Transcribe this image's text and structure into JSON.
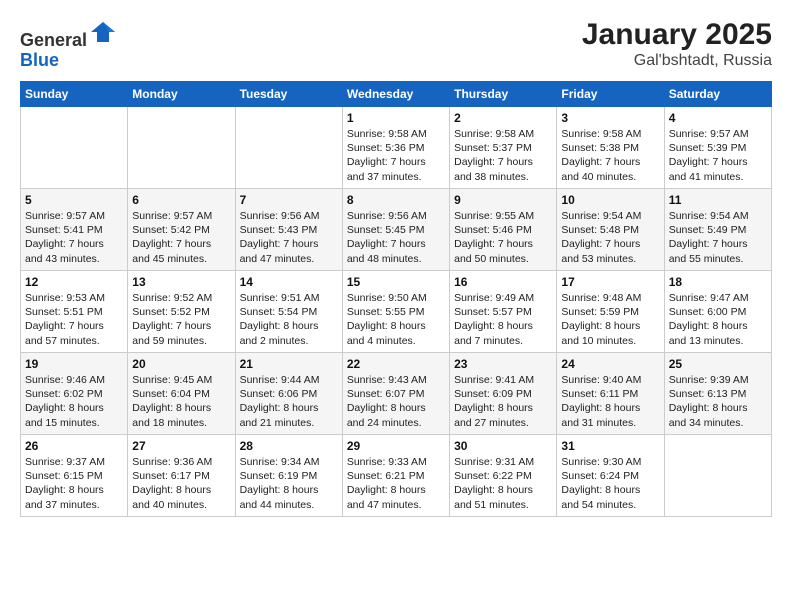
{
  "header": {
    "logo_line1": "General",
    "logo_line2": "Blue",
    "title": "January 2025",
    "subtitle": "Gal'bshtadt, Russia"
  },
  "weekdays": [
    "Sunday",
    "Monday",
    "Tuesday",
    "Wednesday",
    "Thursday",
    "Friday",
    "Saturday"
  ],
  "weeks": [
    [
      {
        "day": "",
        "info": ""
      },
      {
        "day": "",
        "info": ""
      },
      {
        "day": "",
        "info": ""
      },
      {
        "day": "1",
        "info": "Sunrise: 9:58 AM\nSunset: 5:36 PM\nDaylight: 7 hours\nand 37 minutes."
      },
      {
        "day": "2",
        "info": "Sunrise: 9:58 AM\nSunset: 5:37 PM\nDaylight: 7 hours\nand 38 minutes."
      },
      {
        "day": "3",
        "info": "Sunrise: 9:58 AM\nSunset: 5:38 PM\nDaylight: 7 hours\nand 40 minutes."
      },
      {
        "day": "4",
        "info": "Sunrise: 9:57 AM\nSunset: 5:39 PM\nDaylight: 7 hours\nand 41 minutes."
      }
    ],
    [
      {
        "day": "5",
        "info": "Sunrise: 9:57 AM\nSunset: 5:41 PM\nDaylight: 7 hours\nand 43 minutes."
      },
      {
        "day": "6",
        "info": "Sunrise: 9:57 AM\nSunset: 5:42 PM\nDaylight: 7 hours\nand 45 minutes."
      },
      {
        "day": "7",
        "info": "Sunrise: 9:56 AM\nSunset: 5:43 PM\nDaylight: 7 hours\nand 47 minutes."
      },
      {
        "day": "8",
        "info": "Sunrise: 9:56 AM\nSunset: 5:45 PM\nDaylight: 7 hours\nand 48 minutes."
      },
      {
        "day": "9",
        "info": "Sunrise: 9:55 AM\nSunset: 5:46 PM\nDaylight: 7 hours\nand 50 minutes."
      },
      {
        "day": "10",
        "info": "Sunrise: 9:54 AM\nSunset: 5:48 PM\nDaylight: 7 hours\nand 53 minutes."
      },
      {
        "day": "11",
        "info": "Sunrise: 9:54 AM\nSunset: 5:49 PM\nDaylight: 7 hours\nand 55 minutes."
      }
    ],
    [
      {
        "day": "12",
        "info": "Sunrise: 9:53 AM\nSunset: 5:51 PM\nDaylight: 7 hours\nand 57 minutes."
      },
      {
        "day": "13",
        "info": "Sunrise: 9:52 AM\nSunset: 5:52 PM\nDaylight: 7 hours\nand 59 minutes."
      },
      {
        "day": "14",
        "info": "Sunrise: 9:51 AM\nSunset: 5:54 PM\nDaylight: 8 hours\nand 2 minutes."
      },
      {
        "day": "15",
        "info": "Sunrise: 9:50 AM\nSunset: 5:55 PM\nDaylight: 8 hours\nand 4 minutes."
      },
      {
        "day": "16",
        "info": "Sunrise: 9:49 AM\nSunset: 5:57 PM\nDaylight: 8 hours\nand 7 minutes."
      },
      {
        "day": "17",
        "info": "Sunrise: 9:48 AM\nSunset: 5:59 PM\nDaylight: 8 hours\nand 10 minutes."
      },
      {
        "day": "18",
        "info": "Sunrise: 9:47 AM\nSunset: 6:00 PM\nDaylight: 8 hours\nand 13 minutes."
      }
    ],
    [
      {
        "day": "19",
        "info": "Sunrise: 9:46 AM\nSunset: 6:02 PM\nDaylight: 8 hours\nand 15 minutes."
      },
      {
        "day": "20",
        "info": "Sunrise: 9:45 AM\nSunset: 6:04 PM\nDaylight: 8 hours\nand 18 minutes."
      },
      {
        "day": "21",
        "info": "Sunrise: 9:44 AM\nSunset: 6:06 PM\nDaylight: 8 hours\nand 21 minutes."
      },
      {
        "day": "22",
        "info": "Sunrise: 9:43 AM\nSunset: 6:07 PM\nDaylight: 8 hours\nand 24 minutes."
      },
      {
        "day": "23",
        "info": "Sunrise: 9:41 AM\nSunset: 6:09 PM\nDaylight: 8 hours\nand 27 minutes."
      },
      {
        "day": "24",
        "info": "Sunrise: 9:40 AM\nSunset: 6:11 PM\nDaylight: 8 hours\nand 31 minutes."
      },
      {
        "day": "25",
        "info": "Sunrise: 9:39 AM\nSunset: 6:13 PM\nDaylight: 8 hours\nand 34 minutes."
      }
    ],
    [
      {
        "day": "26",
        "info": "Sunrise: 9:37 AM\nSunset: 6:15 PM\nDaylight: 8 hours\nand 37 minutes."
      },
      {
        "day": "27",
        "info": "Sunrise: 9:36 AM\nSunset: 6:17 PM\nDaylight: 8 hours\nand 40 minutes."
      },
      {
        "day": "28",
        "info": "Sunrise: 9:34 AM\nSunset: 6:19 PM\nDaylight: 8 hours\nand 44 minutes."
      },
      {
        "day": "29",
        "info": "Sunrise: 9:33 AM\nSunset: 6:21 PM\nDaylight: 8 hours\nand 47 minutes."
      },
      {
        "day": "30",
        "info": "Sunrise: 9:31 AM\nSunset: 6:22 PM\nDaylight: 8 hours\nand 51 minutes."
      },
      {
        "day": "31",
        "info": "Sunrise: 9:30 AM\nSunset: 6:24 PM\nDaylight: 8 hours\nand 54 minutes."
      },
      {
        "day": "",
        "info": ""
      }
    ]
  ]
}
